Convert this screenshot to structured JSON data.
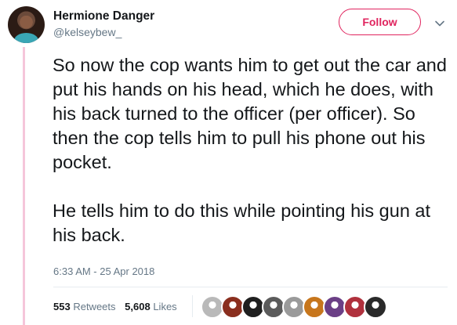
{
  "author": {
    "display_name": "Hermione Danger",
    "handle": "@kelseybew_"
  },
  "follow_label": "Follow",
  "tweet": {
    "paragraphs": [
      "So now the cop wants him to get out the car and put his hands on his head, which he does, with his back turned to the officer (per officer). So then the cop tells him to pull his phone out his pocket.",
      "He tells him to do this while pointing his gun at his back."
    ],
    "timestamp": "6:33 AM - 25 Apr 2018"
  },
  "stats": {
    "retweets_count": "553",
    "retweets_label": "Retweets",
    "likes_count": "5,608",
    "likes_label": "Likes"
  },
  "likers": [
    {
      "icon": "liker-avatar-1",
      "color": "#b9b9b9"
    },
    {
      "icon": "liker-avatar-2",
      "color": "#8a2e1e"
    },
    {
      "icon": "liker-avatar-3",
      "color": "#1f1f1f"
    },
    {
      "icon": "liker-avatar-4",
      "color": "#5b5b5b"
    },
    {
      "icon": "liker-avatar-5",
      "color": "#9a9a9a"
    },
    {
      "icon": "liker-avatar-6",
      "color": "#c7761c"
    },
    {
      "icon": "liker-avatar-7",
      "color": "#6b3f86"
    },
    {
      "icon": "liker-avatar-8",
      "color": "#b0313d"
    },
    {
      "icon": "liker-avatar-9",
      "color": "#2a2a2a"
    }
  ],
  "colors": {
    "follow_accent": "#e0245e",
    "thread_line": "#f5c6da",
    "muted_text": "#657786"
  }
}
